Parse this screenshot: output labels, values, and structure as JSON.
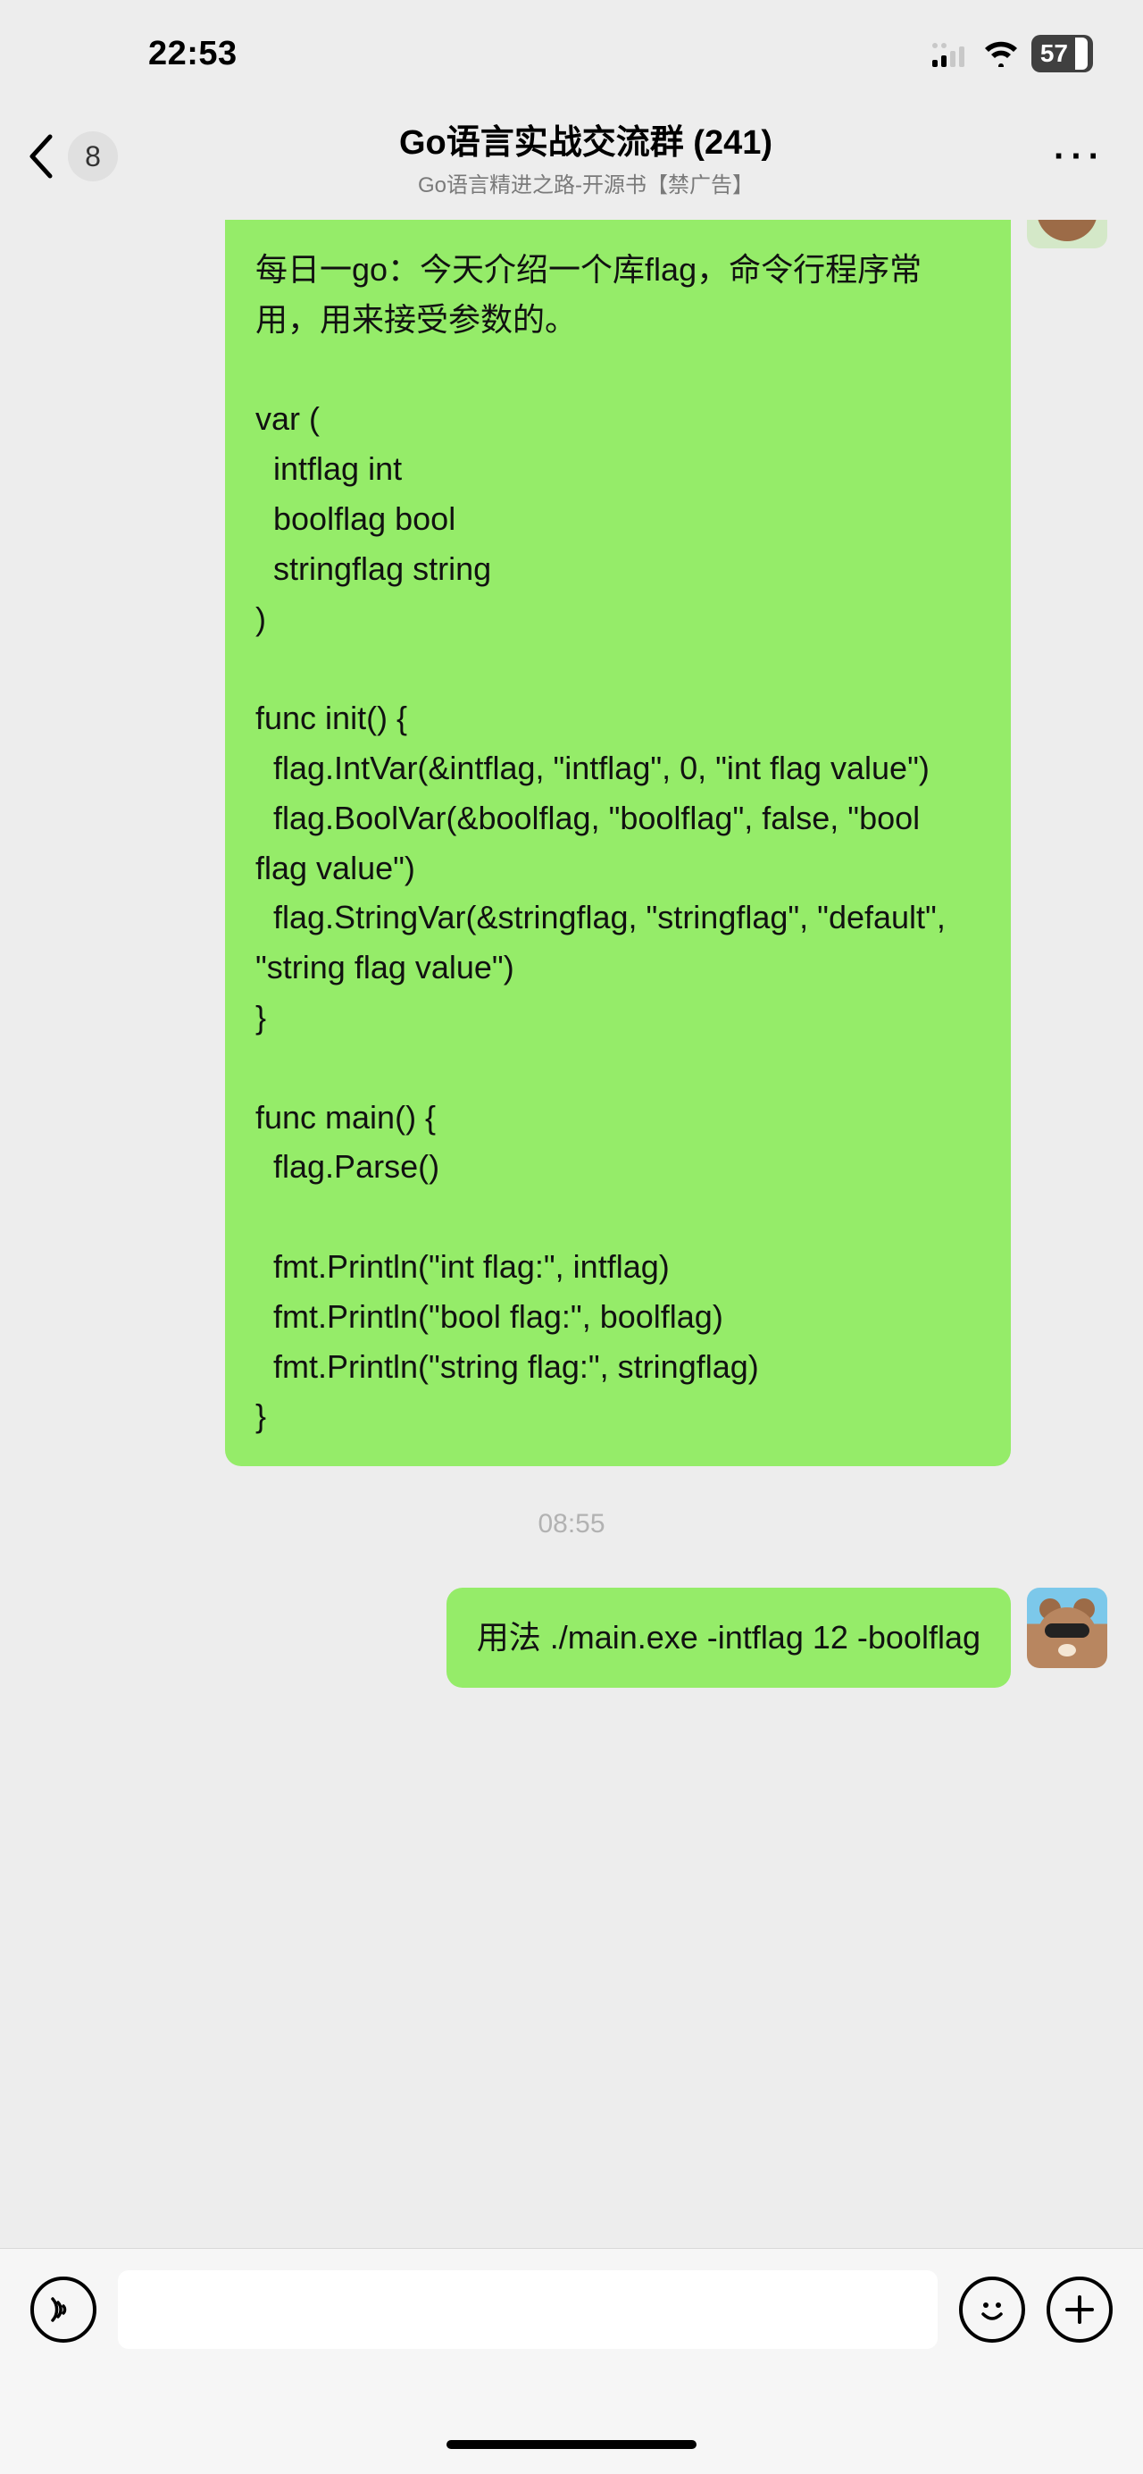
{
  "status": {
    "time": "22:53",
    "battery": "57"
  },
  "header": {
    "back_badge": "8",
    "title": "Go语言实战交流群 (241)",
    "subtitle": "Go语言精进之路-开源书【禁广告】"
  },
  "timeline": {
    "ts1": "08:55"
  },
  "messages": {
    "m1": "每日一go：今天介绍一个库flag，命令行程序常用，用来接受参数的。\n\nvar (\n  intflag int\n  boolflag bool\n  stringflag string\n)\n\nfunc init() {\n  flag.IntVar(&intflag, \"intflag\", 0, \"int flag value\")\n  flag.BoolVar(&boolflag, \"boolflag\", false, \"bool flag value\")\n  flag.StringVar(&stringflag, \"stringflag\", \"default\", \"string flag value\")\n}\n\nfunc main() {\n  flag.Parse()\n\n  fmt.Println(\"int flag:\", intflag)\n  fmt.Println(\"bool flag:\", boolflag)\n  fmt.Println(\"string flag:\", stringflag)\n}",
    "m2": "用法 ./main.exe -intflag 12 -boolflag"
  },
  "icons": {
    "voice": "voice-icon",
    "emoji": "emoji-icon",
    "plus": "plus-icon",
    "back": "chevron-left-icon",
    "more": "more-icon",
    "signal": "signal-icon",
    "wifi": "wifi-icon",
    "battery": "battery-icon",
    "avatar_bear": "bear-avatar-icon",
    "avatar_bear_cool": "bear-sunglasses-avatar-icon"
  }
}
